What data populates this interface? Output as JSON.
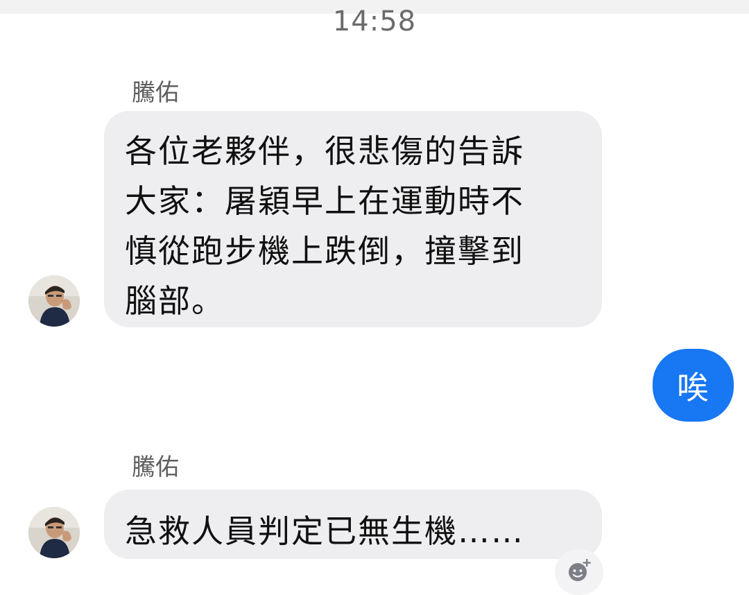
{
  "chat": {
    "timestamp": "14:58",
    "messages": [
      {
        "sender": "騰佑",
        "lines": [
          "各位老夥伴，很悲傷的告訴",
          "大家：屠穎早上在運動時不",
          "慎從跑步機上跌倒，撞擊到",
          "腦部。"
        ]
      },
      {
        "outgoing_text": "唉"
      },
      {
        "sender": "騰佑",
        "lines": [
          "急救人員判定已無生機……"
        ]
      }
    ]
  },
  "icons": {
    "avatar": "user-avatar-photo",
    "reaction": "add-reaction-smiley-icon"
  },
  "colors": {
    "incoming_bubble": "#eeeef1",
    "outgoing_bubble": "#1877f2",
    "timestamp_text": "#6b6b6b",
    "sender_text": "#5f5f5f"
  }
}
